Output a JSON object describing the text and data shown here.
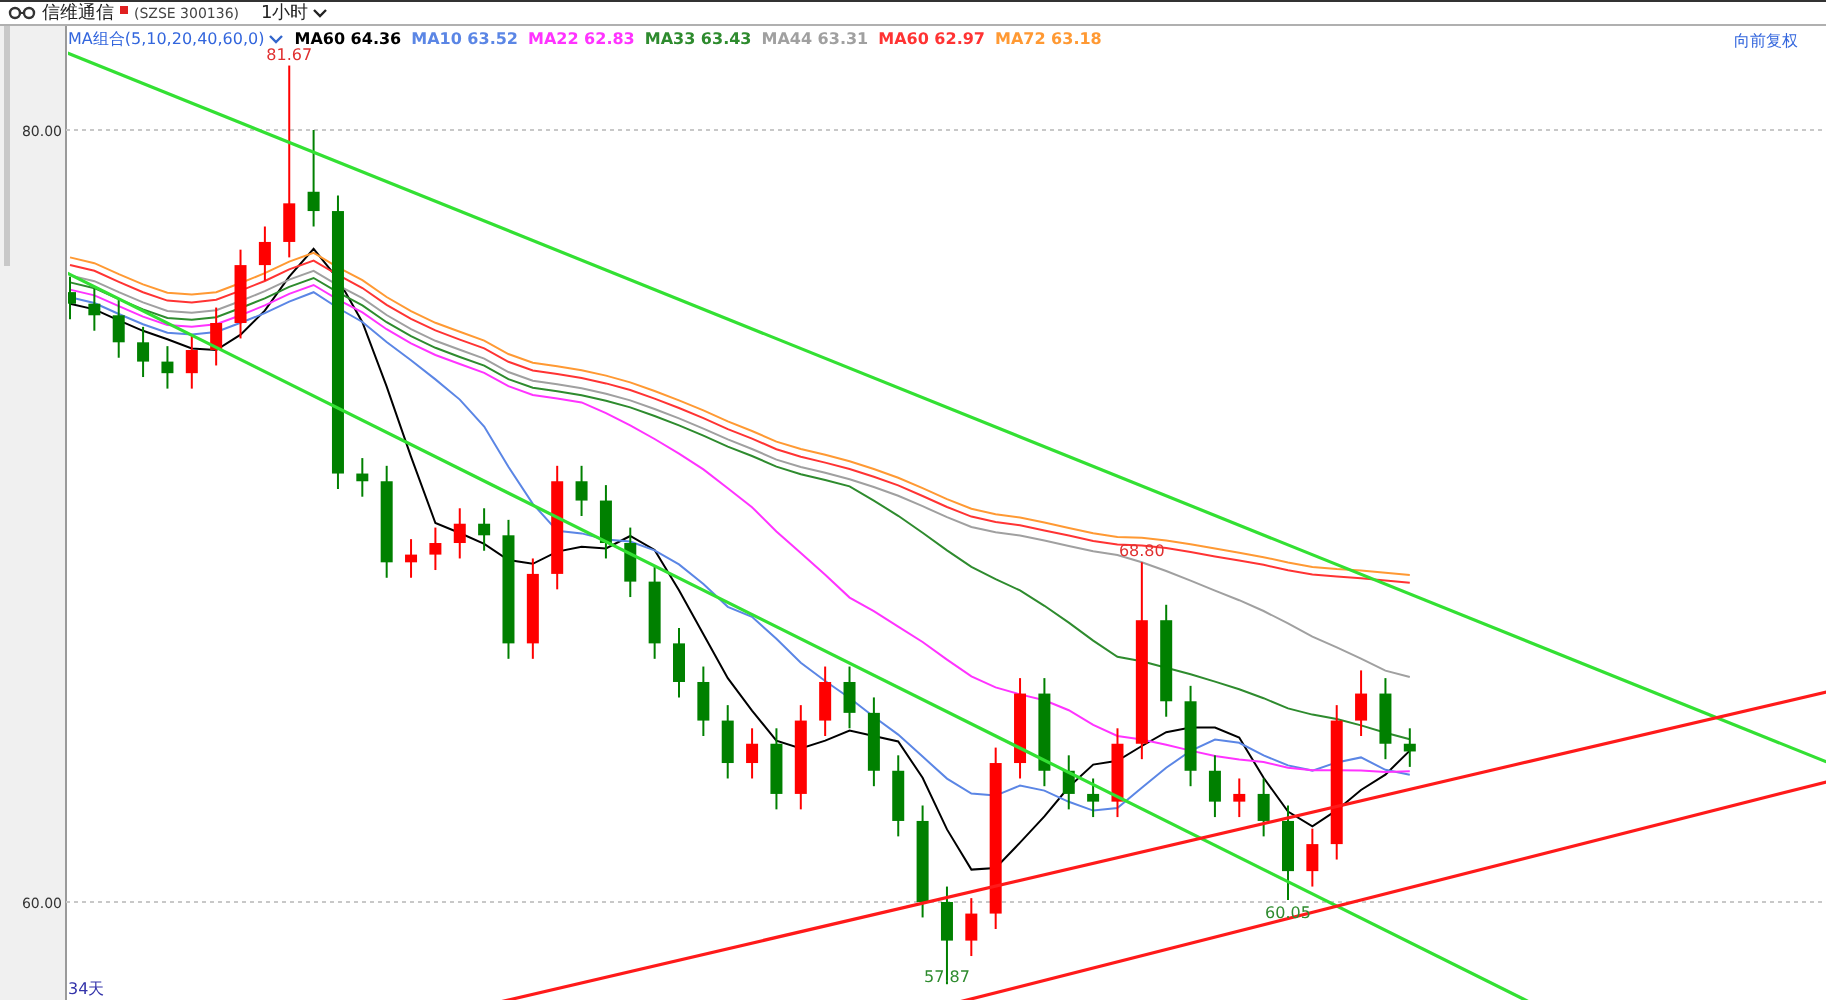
{
  "header": {
    "title": "信维通信",
    "code": "(SZSE 300136)",
    "period": "1小时"
  },
  "legend": {
    "preset": "MA组合(5,10,20,40,60,0)",
    "items": [
      {
        "label": "MA60 64.36",
        "color": "#000000"
      },
      {
        "label": "MA10 63.52",
        "color": "#5b86e5"
      },
      {
        "label": "MA22 62.83",
        "color": "#ff33ff"
      },
      {
        "label": "MA33 63.43",
        "color": "#2e8b2e"
      },
      {
        "label": "MA44 63.31",
        "color": "#a0a0a0"
      },
      {
        "label": "MA60 62.97",
        "color": "#ff3333"
      },
      {
        "label": "MA72 63.18",
        "color": "#ff9933"
      }
    ]
  },
  "adjust_label": "向前复权",
  "span_label": "34天",
  "price_chart": {
    "y_labels": [
      "80.00",
      "60.00"
    ],
    "price_labels": [
      {
        "text": "81.67",
        "color": "#e03030"
      },
      {
        "text": "68.80",
        "color": "#e03030"
      },
      {
        "text": "57.87",
        "color": "#2e8b2e"
      },
      {
        "text": "60.05",
        "color": "#2e8b2e"
      }
    ]
  }
}
